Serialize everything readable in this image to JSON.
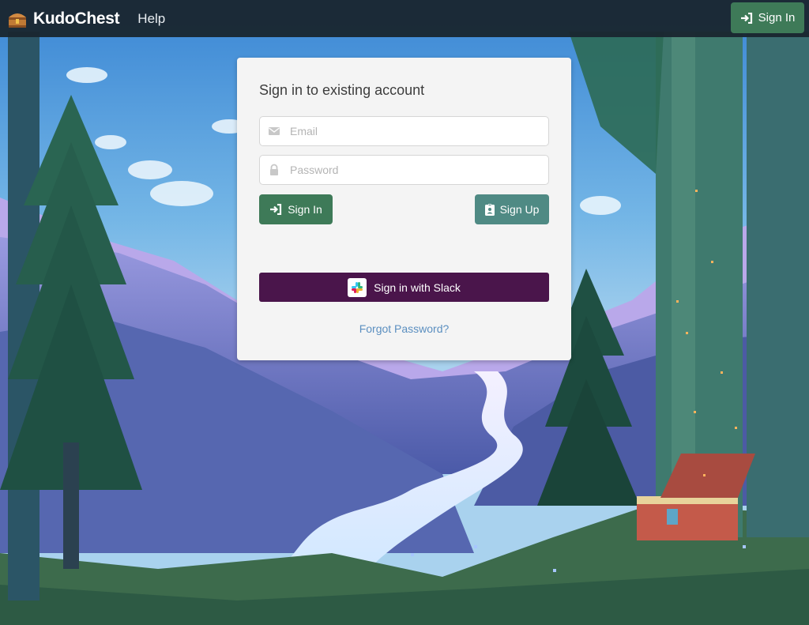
{
  "navbar": {
    "brand_name": "KudoChest",
    "help_label": "Help",
    "signin_label": "Sign In"
  },
  "card": {
    "title": "Sign in to existing account",
    "email_placeholder": "Email",
    "password_placeholder": "Password",
    "signin_label": "Sign In",
    "signup_label": "Sign Up",
    "slack_label": "Sign in with Slack",
    "forgot_label": "Forgot Password?"
  },
  "colors": {
    "navbar_bg": "#1a2630",
    "primary_green": "#3e7a58",
    "teal": "#4f8a84",
    "slack_purple": "#4a154b",
    "link_blue": "#5b8fc0",
    "card_bg": "#f4f4f4"
  },
  "icons": {
    "brand": "treasure-chest-icon",
    "signin": "sign-in-arrow-icon",
    "signup": "id-badge-icon",
    "email": "envelope-icon",
    "password": "lock-icon",
    "slack": "slack-icon"
  }
}
